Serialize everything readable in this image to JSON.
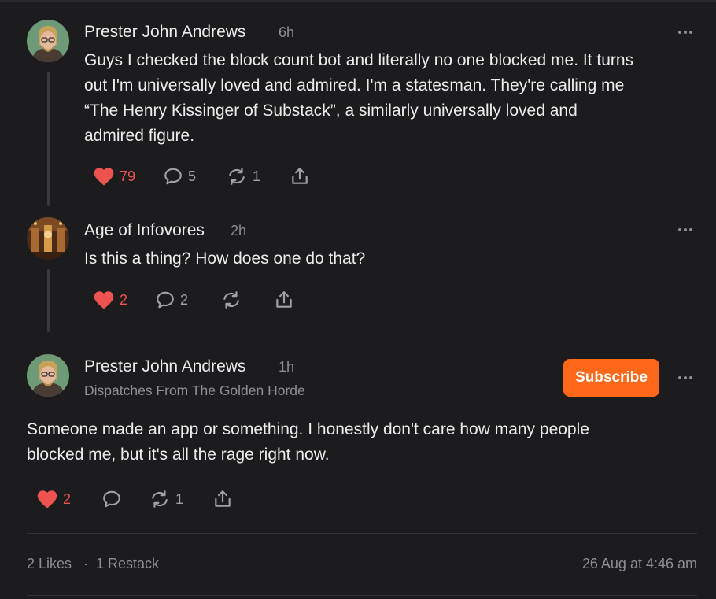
{
  "colors": {
    "background": "#1c1c1e",
    "like_red": "#ef5350",
    "subscribe_orange": "#ff6719",
    "muted": "#8e8e93"
  },
  "comments": [
    {
      "author": "Prester John Andrews",
      "time": "6h",
      "body_lines": [
        "Guys I checked the block count bot and literally no one blocked me. It turns",
        "out I'm universally loved and admired. I'm a statesman. They're calling me",
        "“The Henry Kissinger of Substack”, a similarly universally loved and",
        "admired figure."
      ],
      "likes": "79",
      "replies": "5",
      "restacks": "1"
    },
    {
      "author": "Age of Infovores",
      "time": "2h",
      "body_lines": [
        "Is this a thing? How does one do that?"
      ],
      "likes": "2",
      "replies": "2"
    }
  ],
  "post": {
    "author": "Prester John Andrews",
    "time": "1h",
    "publication": "Dispatches From The Golden Horde",
    "subscribe_label": "Subscribe",
    "body_lines": [
      "Someone made an app or something. I honestly don't care how many people",
      "blocked me, but it's all the rage right now."
    ],
    "likes": "2",
    "restacks": "1"
  },
  "footer": {
    "likes_text": "2 Likes",
    "separator": "·",
    "restacks_text": "1 Restack",
    "timestamp": "26 Aug at 4:46 am"
  },
  "icons": {
    "like": "heart-icon",
    "reply": "speech-bubble-icon",
    "restack": "restack-arrows-icon",
    "share": "share-upload-icon",
    "more": "more-dots-icon"
  }
}
